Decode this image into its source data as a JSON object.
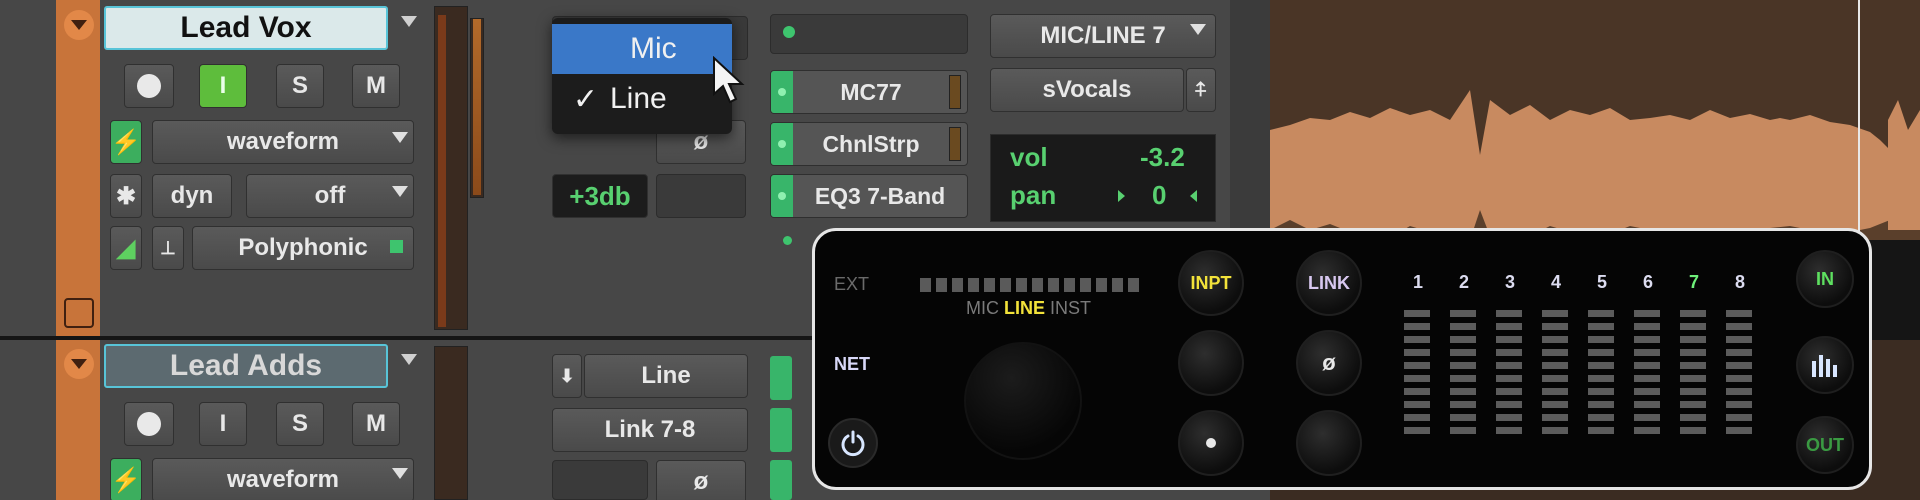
{
  "tracks": [
    {
      "name": "Lead Vox",
      "buttons": {
        "record": "",
        "input": "I",
        "solo": "S",
        "mute": "M"
      },
      "view": "waveform",
      "dyn": "dyn",
      "dyn_value": "off",
      "elastic": "Polyphonic",
      "gain": "+3db",
      "phase": "ø",
      "input_route": "MIC/LINE 7",
      "output_route": "sVocals",
      "inserts": [
        "MC77",
        "ChnlStrp",
        "EQ3 7-Band"
      ],
      "vol_label": "vol",
      "vol_value": "-3.2",
      "pan_label": "pan",
      "pan_value": "0"
    },
    {
      "name": "Lead Adds",
      "buttons": {
        "record": "",
        "input": "I",
        "solo": "S",
        "mute": "M"
      },
      "view": "waveform",
      "input_type": "Line",
      "input_link": "Link 7-8",
      "phase": "ø"
    }
  ],
  "popup_menu": {
    "items": [
      {
        "label": "Mic",
        "selected": false,
        "highlighted": true
      },
      {
        "label": "Line",
        "selected": true,
        "check": "✓"
      }
    ]
  },
  "hardware": {
    "ext_label": "EXT",
    "net_label": "NET",
    "source_labels": [
      "MIC",
      "LINE",
      "INST"
    ],
    "active_source": "LINE",
    "buttons": [
      "INPT",
      "LINK",
      "ø"
    ],
    "channels": [
      "1",
      "2",
      "3",
      "4",
      "5",
      "6",
      "7",
      "8"
    ],
    "in_label": "IN",
    "out_label": "OUT"
  }
}
